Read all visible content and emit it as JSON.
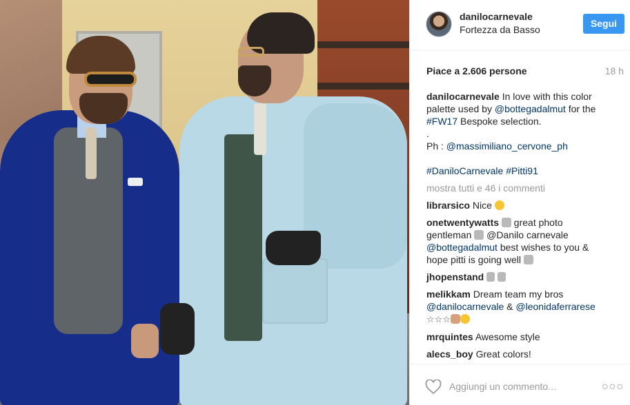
{
  "post": {
    "username": "danilocarnevale",
    "location": "Fortezza da Basso",
    "follow_label": "Segui",
    "likes": "Piace a 2.606 persone",
    "time": "18 h",
    "caption": {
      "username": "danilocarnevale",
      "line1": "In love with this color",
      "line2_a": "palette used by ",
      "mention1": "@bottegadalmut",
      "line2_b": " for the",
      "hashtag1": "#FW17",
      "line3_b": " Bespoke selection.",
      "dot": ".",
      "ph_label": "Ph : ",
      "mention2": "@massimiliano_cervone_ph",
      "hashtag2": "#DaniloCarnevale",
      "hashtag3": "#Pitti91"
    },
    "show_all": "mostra tutti e 46 i commenti",
    "comments": [
      {
        "user": "librarsico",
        "text": "Nice"
      },
      {
        "user": "onetwentywatts",
        "text_a": " great photo",
        "text_b": "gentleman ",
        "text_c": " @Danilo carnevale",
        "mention": "@bottegadalmut",
        "text_d": " best wishes to you &",
        "text_e": "hope pitti is going well "
      },
      {
        "user": "jhopenstand",
        "text": ""
      },
      {
        "user": "melikkam",
        "text": "Dream team my bros",
        "mention1": "@danilocarnevale",
        "amp": " & ",
        "mention2": "@leonidaferrarese",
        "stars": "☆☆☆"
      },
      {
        "user": "mrquintes",
        "text": "Awesome style"
      },
      {
        "user": "alecs_boy",
        "text": "Great colors!"
      }
    ],
    "add_comment_placeholder": "Aggiungi un commento...",
    "more_label": "○○○"
  }
}
